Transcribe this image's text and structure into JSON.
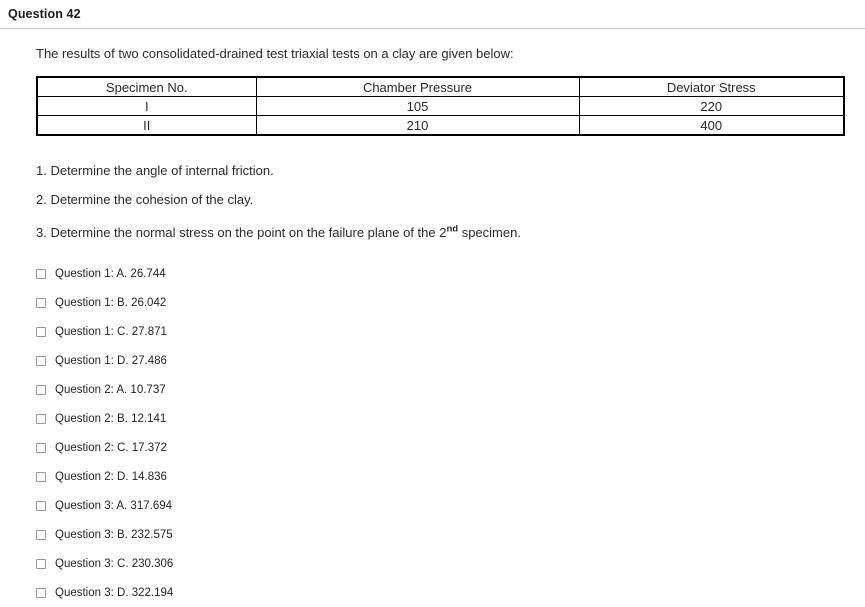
{
  "header": {
    "title": "Question 42"
  },
  "main": {
    "intro": "The results of two consolidated-drained test triaxial tests on a clay are given below:",
    "table": {
      "columns": [
        "Specimen No.",
        "Chamber Pressure",
        "Deviator Stress"
      ],
      "rows": [
        [
          "I",
          "105",
          "220"
        ],
        [
          "II",
          "210",
          "400"
        ]
      ]
    },
    "prompts": [
      {
        "text": "1. Determine the angle of internal friction."
      },
      {
        "text": "2. Determine the cohesion of the clay."
      },
      {
        "pre": "3. Determine the normal stress on the point on the failure plane of the 2",
        "sup": "nd",
        "post": " specimen."
      }
    ],
    "choices": [
      {
        "label": "Question 1: A. 26.744"
      },
      {
        "label": "Question 1: B. 26.042"
      },
      {
        "label": "Question 1: C. 27.871"
      },
      {
        "label": "Question 1: D. 27.486"
      },
      {
        "label": "Question 2: A. 10.737"
      },
      {
        "label": "Question 2: B. 12.141"
      },
      {
        "label": "Question 2: C. 17.372"
      },
      {
        "label": "Question 2: D. 14.836"
      },
      {
        "label": "Question 3: A. 317.694"
      },
      {
        "label": "Question 3: B. 232.575"
      },
      {
        "label": "Question 3: C. 230.306"
      },
      {
        "label": "Question 3: D. 322.194"
      }
    ]
  }
}
